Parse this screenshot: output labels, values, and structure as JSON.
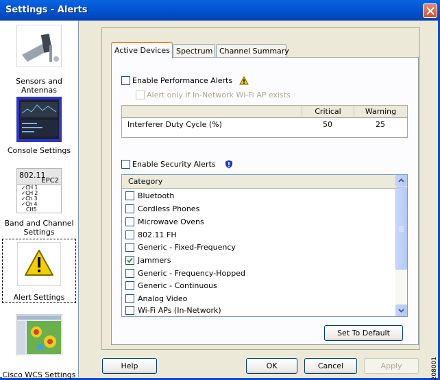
{
  "window": {
    "title": "Settings - Alerts"
  },
  "sidebar": {
    "items": [
      {
        "label": "Sensors and Antennas"
      },
      {
        "label": "Console Settings"
      },
      {
        "label": "Band and Channel Settings",
        "icon_title": "802.11",
        "icon_sub": "EPC2",
        "channels": [
          "CH 1",
          "CH 2",
          "Ch 3",
          "Ch 4",
          "CH5"
        ]
      },
      {
        "label": "Alert Settings"
      },
      {
        "label": "Cisco WCS Settings"
      }
    ]
  },
  "tabs": [
    {
      "label": "Active Devices",
      "active": true
    },
    {
      "label": "Spectrum",
      "active": false
    },
    {
      "label": "Channel Summary",
      "active": false
    }
  ],
  "performance": {
    "enable_label": "Enable Performance Alerts",
    "in_network_label": "Alert only if In-Network Wi-Fi AP exists",
    "headers": [
      "",
      "Critical",
      "Warning"
    ],
    "rows": [
      {
        "name": "Interferer Duty Cycle (%)",
        "critical": "50",
        "warning": "25"
      }
    ]
  },
  "security": {
    "enable_label": "Enable Security Alerts",
    "column_header": "Category",
    "categories": [
      {
        "label": "Bluetooth",
        "checked": false
      },
      {
        "label": "Cordless Phones",
        "checked": false
      },
      {
        "label": "Microwave Ovens",
        "checked": false
      },
      {
        "label": "802.11 FH",
        "checked": false
      },
      {
        "label": "Generic - Fixed-Frequency",
        "checked": false
      },
      {
        "label": "Jammers",
        "checked": true
      },
      {
        "label": "Generic - Frequency-Hopped",
        "checked": false
      },
      {
        "label": "Generic - Continuous",
        "checked": false
      },
      {
        "label": "Analog Video",
        "checked": false
      },
      {
        "label": "Wi-Fi APs (In-Network)",
        "checked": false
      }
    ]
  },
  "buttons": {
    "set_default": "Set To Default",
    "help": "Help",
    "ok": "OK",
    "cancel": "Cancel",
    "apply": "Apply"
  },
  "figure_id": "208001",
  "colors": {
    "titlebar": "#0356d4",
    "close": "#d3502d",
    "tab_accent": "#e68b2c",
    "warning_icon": "#f5d000",
    "shield_icon": "#1c3ec4"
  }
}
